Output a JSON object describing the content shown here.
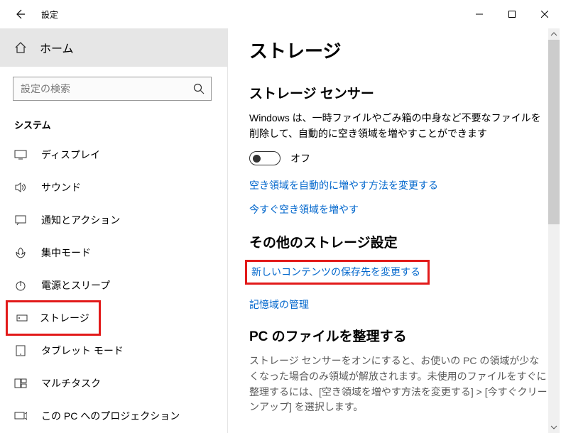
{
  "window": {
    "title": "設定"
  },
  "sidebar": {
    "home": "ホーム",
    "search_placeholder": "設定の検索",
    "section": "システム",
    "items": [
      {
        "label": "ディスプレイ"
      },
      {
        "label": "サウンド"
      },
      {
        "label": "通知とアクション"
      },
      {
        "label": "集中モード"
      },
      {
        "label": "電源とスリープ"
      },
      {
        "label": "ストレージ"
      },
      {
        "label": "タブレット モード"
      },
      {
        "label": "マルチタスク"
      },
      {
        "label": "この PC へのプロジェクション"
      }
    ]
  },
  "main": {
    "title": "ストレージ",
    "sense_h": "ストレージ センサー",
    "sense_desc": "Windows は、一時ファイルやごみ箱の中身など不要なファイルを削除して、自動的に空き領域を増やすことができます",
    "toggle_state": "オフ",
    "link_change_auto": "空き領域を自動的に増やす方法を変更する",
    "link_free_now": "今すぐ空き領域を増やす",
    "other_h": "その他のストレージ設定",
    "link_new_content": "新しいコンテンツの保存先を変更する",
    "link_storage_mgmt": "記憶域の管理",
    "organize_h": "PC のファイルを整理する",
    "organize_desc": "ストレージ センサーをオンにすると、お使いの PC の領域が少なくなった場合のみ領域が解放されます。未使用のファイルをすぐに整理するには、[空き領域を増やす方法を変更する] > [今すぐクリーンアップ] を選択します。"
  }
}
